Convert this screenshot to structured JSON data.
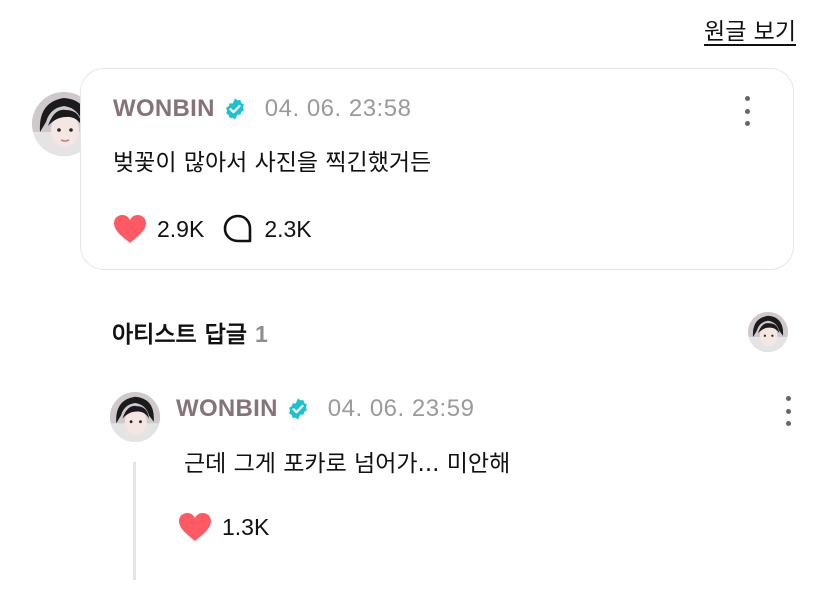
{
  "header": {
    "view_original_label": "원글 보기"
  },
  "post": {
    "author": "WONBIN",
    "timestamp": "04. 06. 23:58",
    "text": "벚꽃이 많아서 사진을 찍긴했거든",
    "likes": "2.9K",
    "comments": "2.3K"
  },
  "artist_replies": {
    "title": "아티스트 답글",
    "count": "1"
  },
  "reply": {
    "author": "WONBIN",
    "timestamp": "04. 06. 23:59",
    "text": "근데 그게 포카로 넘어가... 미안해",
    "likes": "1.3K"
  },
  "colors": {
    "author": "#86737a",
    "verified": "#19c3d3",
    "heart": "#ff5a63",
    "timestamp": "#9a9a9a"
  },
  "icons": [
    "verified-icon",
    "heart-icon",
    "comment-icon",
    "more-options-icon",
    "avatar"
  ]
}
